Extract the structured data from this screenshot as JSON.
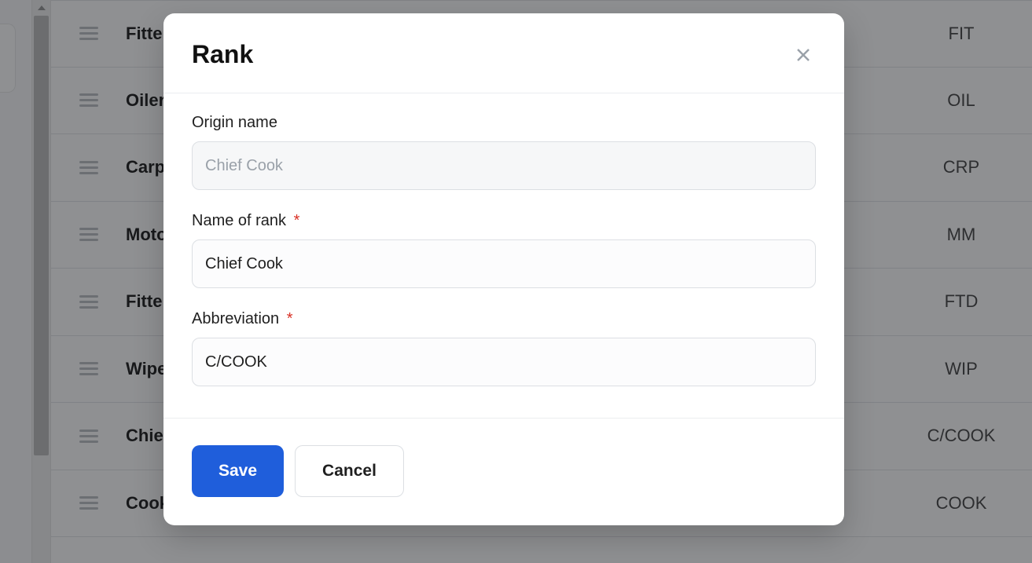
{
  "background": {
    "rows": [
      {
        "name": "Fitter",
        "abbr": "FIT"
      },
      {
        "name": "Oiler",
        "abbr": "OIL"
      },
      {
        "name": "Carpenter",
        "abbr": "CRP"
      },
      {
        "name": "Motorman",
        "abbr": "MM"
      },
      {
        "name": "Fitter",
        "abbr": "FTD"
      },
      {
        "name": "Wiper",
        "abbr": "WIP"
      },
      {
        "name": "Chief Cook",
        "abbr": "C/COOK"
      },
      {
        "name": "Cook",
        "abbr": "COOK"
      }
    ]
  },
  "modal": {
    "title": "Rank",
    "fields": {
      "origin_label": "Origin name",
      "origin_value": "Chief Cook",
      "name_label": "Name of rank",
      "name_value": "Chief Cook",
      "abbr_label": "Abbreviation",
      "abbr_value": "C/COOK",
      "required_mark": "*"
    },
    "actions": {
      "save": "Save",
      "cancel": "Cancel"
    }
  }
}
